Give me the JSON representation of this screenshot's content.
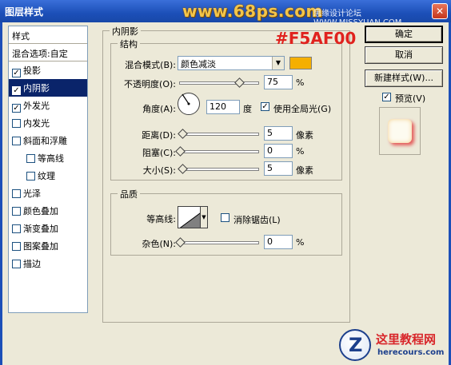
{
  "window": {
    "title": "图层样式",
    "watermark": "www.68ps.com",
    "forum": "思缘设计论坛 WWW.MISSYUAN.COM",
    "close": "✕"
  },
  "style_list": {
    "header": "样式",
    "blend_options": "混合选项:自定",
    "items": [
      {
        "label": "投影",
        "checked": true
      },
      {
        "label": "内阴影",
        "checked": true
      },
      {
        "label": "外发光",
        "checked": true
      },
      {
        "label": "内发光",
        "checked": false
      },
      {
        "label": "斜面和浮雕",
        "checked": false
      },
      {
        "label": "等高线",
        "checked": false
      },
      {
        "label": "纹理",
        "checked": false
      },
      {
        "label": "光泽",
        "checked": false
      },
      {
        "label": "颜色叠加",
        "checked": false
      },
      {
        "label": "渐变叠加",
        "checked": false
      },
      {
        "label": "图案叠加",
        "checked": false
      },
      {
        "label": "描边",
        "checked": false
      }
    ]
  },
  "inner_shadow": {
    "title": "内阴影",
    "structure": {
      "title": "结构",
      "blend_mode_label": "混合模式(B):",
      "blend_mode_value": "颜色减淡",
      "color": "#F5AF00",
      "opacity_label": "不透明度(O):",
      "opacity_value": "75",
      "opacity_unit": "%",
      "opacity_fraction": 0.75,
      "angle_label": "角度(A):",
      "angle_value": "120",
      "angle_unit": "度",
      "global_light_label": "使用全局光(G)",
      "global_light_checked": true,
      "distance_label": "距离(D):",
      "distance_value": "5",
      "distance_unit": "像素",
      "choke_label": "阻塞(C):",
      "choke_value": "0",
      "choke_unit": "%",
      "size_label": "大小(S):",
      "size_value": "5",
      "size_unit": "像素"
    },
    "quality": {
      "title": "品质",
      "contour_label": "等高线:",
      "antialias_label": "消除锯齿(L)",
      "antialias_checked": false,
      "noise_label": "杂色(N):",
      "noise_value": "0",
      "noise_unit": "%"
    }
  },
  "annotation": "#F5AF00",
  "buttons": {
    "ok": "确定",
    "cancel": "取消",
    "new_style": "新建样式(W)...",
    "preview_label": "预览(V)",
    "preview_checked": true
  },
  "logo": {
    "letter": "Z",
    "cn": "这里教程网",
    "en": "herecours.com"
  }
}
